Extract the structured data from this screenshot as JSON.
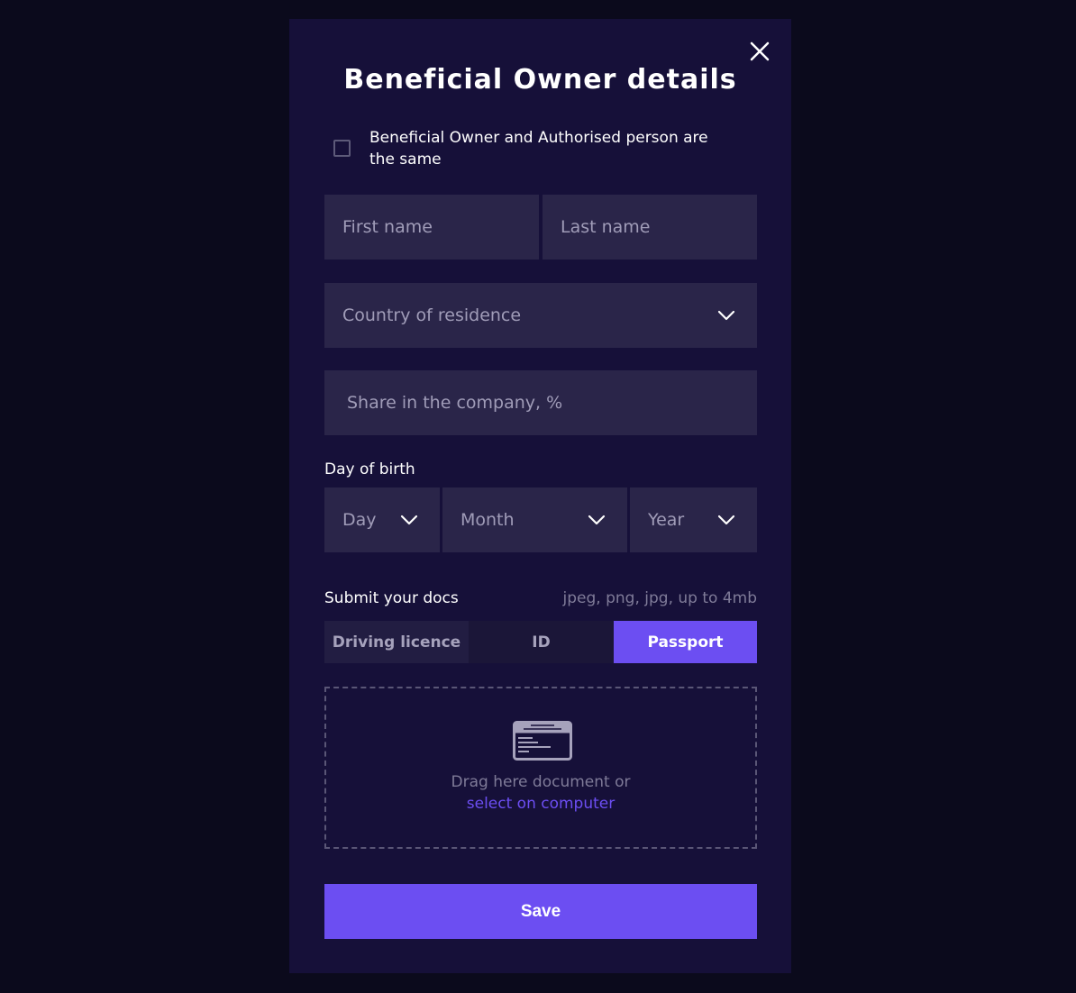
{
  "modal": {
    "title": "Beneficial Owner details",
    "close_icon": "close-icon"
  },
  "same_person": {
    "label": "Beneficial Owner and Authorised person are the same",
    "checked": false
  },
  "fields": {
    "first_name_placeholder": "First name",
    "last_name_placeholder": "Last name",
    "country_placeholder": "Country of residence",
    "share_placeholder": "Share in the company, %"
  },
  "birth": {
    "label": "Day of birth",
    "day": "Day",
    "month": "Month",
    "year": "Year"
  },
  "docs": {
    "label": "Submit your docs",
    "hint": "jpeg, png, jpg, up to 4mb",
    "tabs": [
      "Driving licence",
      "ID",
      "Passport"
    ],
    "active_tab": "Passport",
    "drop_text": "Drag here document or",
    "drop_link": "select on computer"
  },
  "save_label": "Save",
  "colors": {
    "accent": "#6c4ef2",
    "modal_bg": "#161039",
    "field_bg": "#2a2549",
    "page_bg": "#0b0a1c"
  }
}
